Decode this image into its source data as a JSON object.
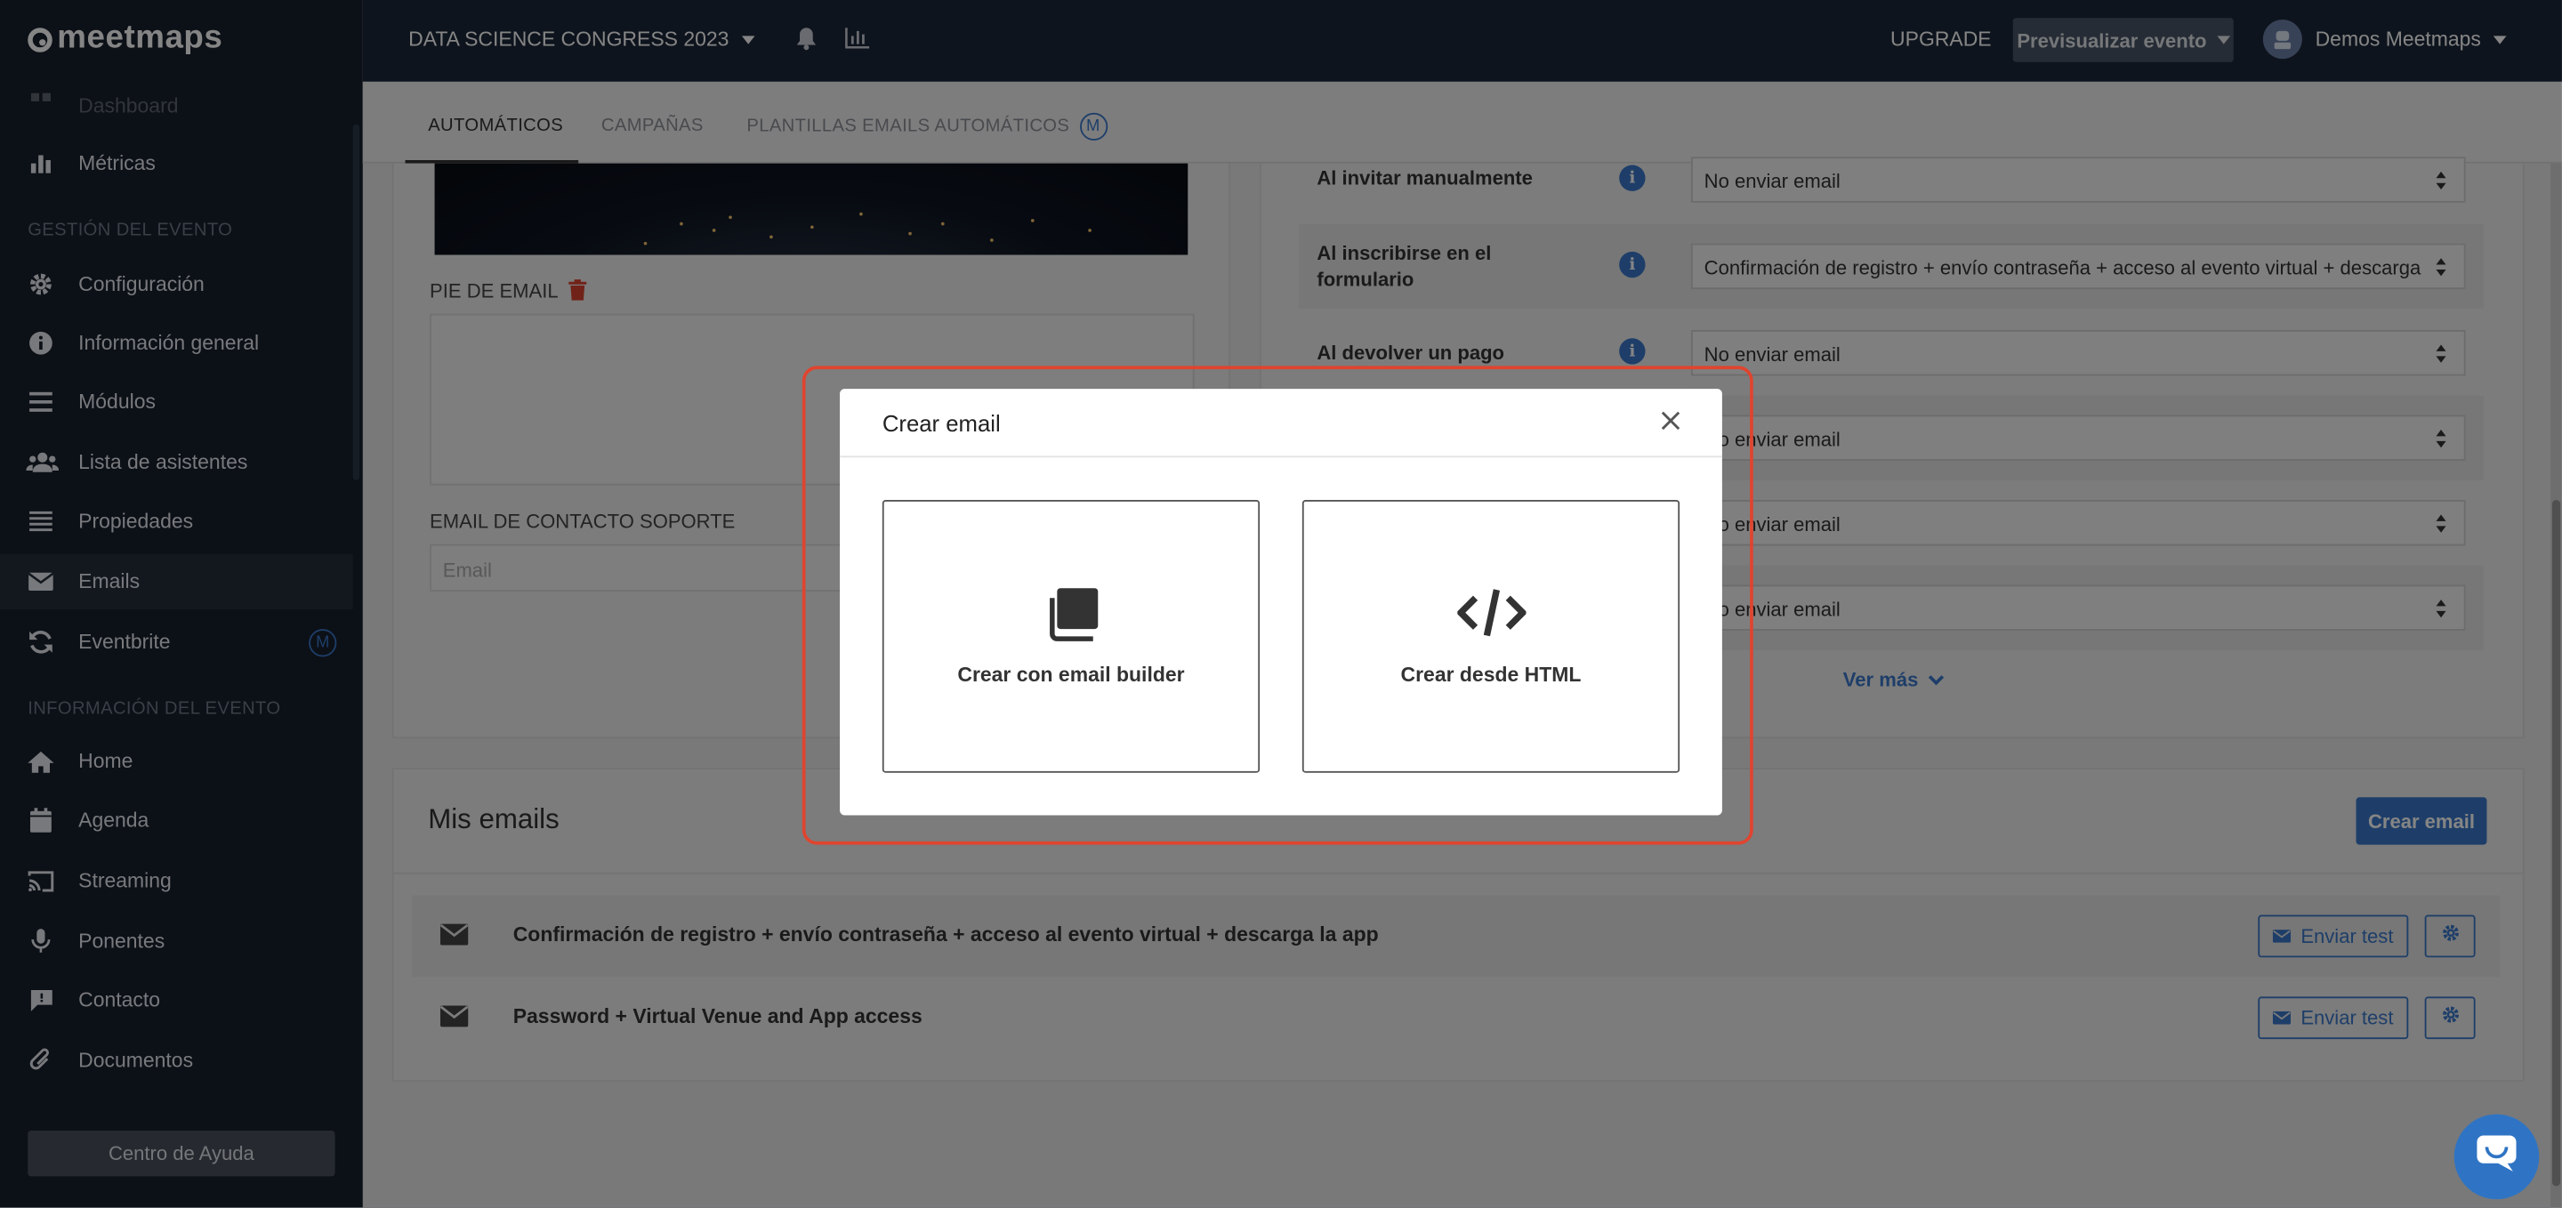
{
  "brand": {
    "name": "meetmaps"
  },
  "topbar": {
    "event_title": "DATA SCIENCE CONGRESS 2023",
    "upgrade": "UPGRADE",
    "preview_button": "Previsualizar evento",
    "user_name": "Demos Meetmaps"
  },
  "sidebar": {
    "partial_item": "Dashboard",
    "metricas": "Métricas",
    "section_gestion": "GESTIÓN DEL EVENTO",
    "configuracion": "Configuración",
    "informacion_general": "Información general",
    "modulos": "Módulos",
    "lista_asistentes": "Lista de asistentes",
    "propiedades": "Propiedades",
    "emails": "Emails",
    "eventbrite": "Eventbrite",
    "eventbrite_badge": "M",
    "section_info": "INFORMACIÓN DEL EVENTO",
    "home": "Home",
    "agenda": "Agenda",
    "streaming": "Streaming",
    "ponentes": "Ponentes",
    "contacto": "Contacto",
    "documentos": "Documentos",
    "help_button": "Centro de Ayuda"
  },
  "tabs": {
    "automaticos": "AUTOMÁTICOS",
    "campanas": "CAMPAÑAS",
    "plantillas": "PLANTILLAS EMAILS AUTOMÁTICOS",
    "plantillas_badge": "M"
  },
  "left_card": {
    "pie_label": "PIE DE EMAIL",
    "contact_label": "EMAIL DE CONTACTO SOPORTE",
    "contact_placeholder": "Email"
  },
  "rules": [
    {
      "label": "Al invitar manualmente",
      "value": "No enviar email"
    },
    {
      "label": "Al inscribirse en el formulario",
      "value": "Confirmación de registro + envío contraseña + acceso al evento virtual + descarga"
    },
    {
      "label": "Al devolver un pago",
      "value": "No enviar email"
    },
    {
      "label": "",
      "value": "No enviar email"
    },
    {
      "label": "",
      "value": "No enviar email"
    },
    {
      "label": "",
      "value": "No enviar email"
    }
  ],
  "ver_mas": "Ver más",
  "mis_emails": {
    "title": "Mis emails",
    "create_button": "Crear email",
    "items": [
      {
        "title": "Confirmación de registro + envío contraseña + acceso al evento virtual + descarga la app",
        "test_button": "Enviar test"
      },
      {
        "title": "Password + Virtual Venue and App access",
        "test_button": "Enviar test"
      }
    ]
  },
  "modal": {
    "title": "Crear email",
    "option_builder": "Crear con email builder",
    "option_html": "Crear desde HTML"
  },
  "colors": {
    "accent": "#3a78c9",
    "sidebar_bg": "#17202c",
    "topbar_bg": "#1b2838",
    "highlight": "#e0442f"
  },
  "icons": [
    "chart-icon",
    "gear-icon",
    "info-icon",
    "list-icon",
    "users-icon",
    "properties-icon",
    "envelope-icon",
    "refresh-icon",
    "home-icon",
    "calendar-icon",
    "cast-icon",
    "microphone-icon",
    "chat-icon",
    "paperclip-icon",
    "bell-icon",
    "stats-icon",
    "trash-icon",
    "close-icon",
    "copy-icon",
    "code-icon",
    "chevron-down-icon"
  ]
}
